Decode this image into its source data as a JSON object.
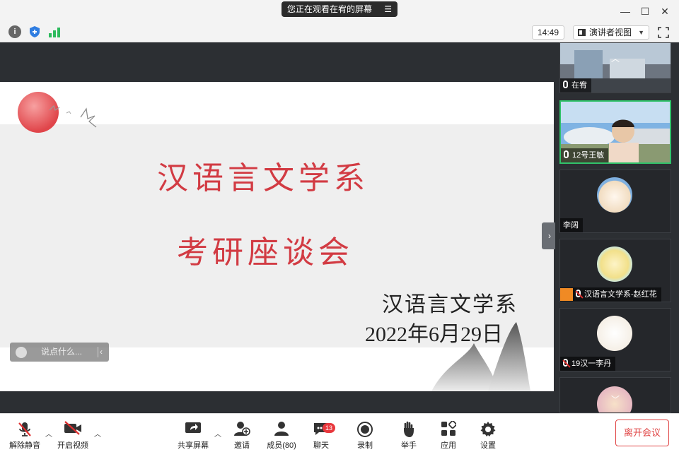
{
  "titlebar": {
    "share_notice": "您正在观看在宥的屏幕",
    "share_menu_icon": "menu-lines-icon"
  },
  "infobar": {
    "time": "14:49",
    "view_mode": "演讲者视图"
  },
  "slide": {
    "title_line1": "汉语言文学系",
    "title_line2": "考研座谈会",
    "subtitle_dept": "汉语言文学系",
    "subtitle_date": "2022年6月29日"
  },
  "chat_input": {
    "placeholder": "说点什么..."
  },
  "participants": [
    {
      "name": "在宥",
      "mic": "on",
      "active": false
    },
    {
      "name": "12号王敏",
      "mic": "on",
      "active": true
    },
    {
      "name": "李阔",
      "mic": "none",
      "active": false
    },
    {
      "name": "汉语言文学系-赵红花",
      "mic": "off",
      "active": false
    },
    {
      "name": "19汉一李丹",
      "mic": "off",
      "active": false
    }
  ],
  "toolbar": {
    "unmute": "解除静音",
    "start_video": "开启视频",
    "share_screen": "共享屏幕",
    "invite": "邀请",
    "members": "成员(80)",
    "chat": "聊天",
    "chat_badge": "13",
    "record": "录制",
    "raise_hand": "举手",
    "apps": "应用",
    "settings": "设置",
    "leave": "离开会议"
  },
  "colors": {
    "accent_red": "#e04545",
    "active_green": "#31c26a",
    "slide_title_red": "#d23b43"
  }
}
